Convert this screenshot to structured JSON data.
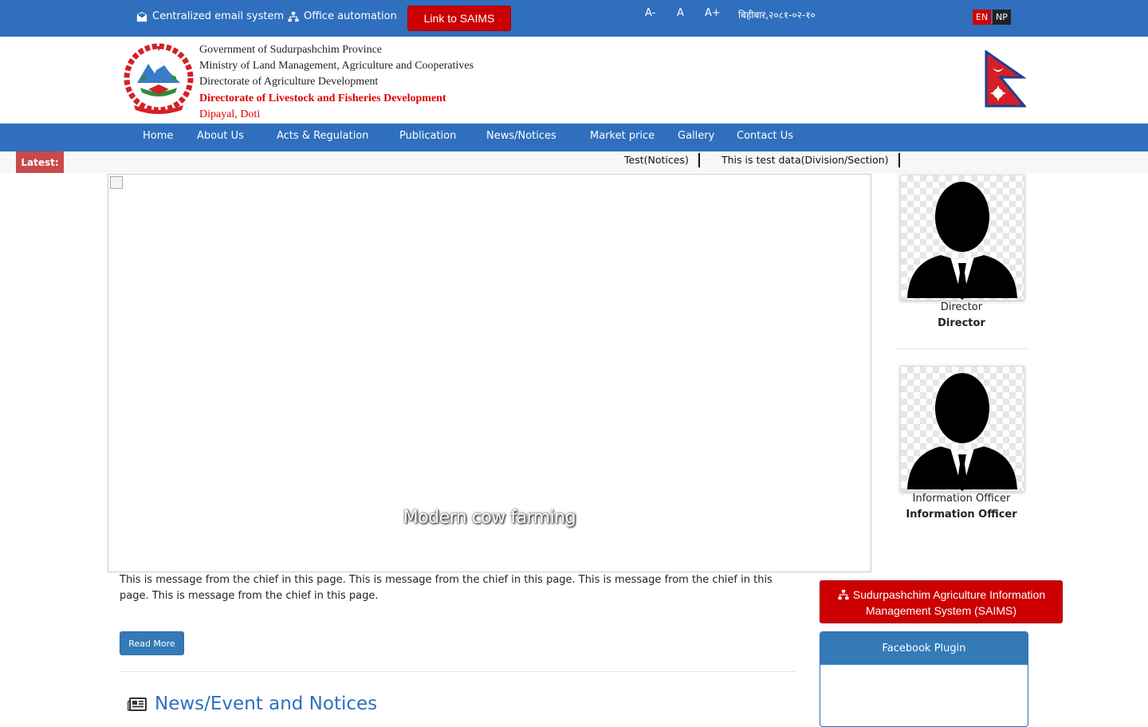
{
  "topbar": {
    "email_link": "Centralized email system",
    "office_link": "Office automation",
    "saims_button": "Link to SAIMS",
    "font_decrease": "A-",
    "font_normal": "A",
    "font_increase": "A+",
    "date": "बिहीबार,२०८१-०२-१०",
    "lang_en": "EN",
    "lang_np": "NP"
  },
  "header": {
    "line1": "Government of Sudurpashchim Province",
    "line2": "Ministry of Land Management, Agriculture and Cooperatives",
    "line3": "Directorate of Agriculture Development",
    "line4": "Directorate of Livestock and Fisheries Development",
    "line5": "Dipayal, Doti"
  },
  "nav": {
    "items": [
      "Home",
      "About Us",
      "Acts & Regulation",
      "Publication",
      "News/Notices",
      "Market price",
      "Gallery",
      "Contact Us"
    ]
  },
  "latest": {
    "label": "Latest:",
    "items": [
      "Test(Notices)",
      "This is test data(Division/Section)"
    ]
  },
  "slider": {
    "caption": "Modern cow farming"
  },
  "message": {
    "text": "This is message from the chief in this page. This is message from the chief in this page. This is message from the chief in this page. This is message from the chief in this page.",
    "read_more": "Read More"
  },
  "news": {
    "heading": "News/Event and Notices"
  },
  "officials": [
    {
      "role": "Director",
      "name": "Director"
    },
    {
      "role": "Information Officer",
      "name": "Information Officer"
    }
  ],
  "sidebar": {
    "saims_panel": "Sudurpashchim Agriculture Information Management System (SAIMS)",
    "facebook_title": "Facebook Plugin"
  },
  "colors": {
    "primary_blue": "#2f6fbd",
    "accent_red": "#cc0000",
    "latest_red": "#c84a4a"
  }
}
